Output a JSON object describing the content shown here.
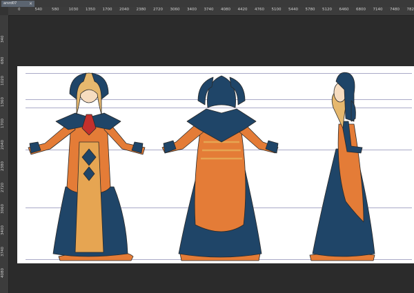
{
  "document": {
    "tab_label": "arsrd07",
    "close_glyph": "×"
  },
  "ruler": {
    "top_labels": [
      "0",
      "540",
      "580",
      "1030",
      "1350",
      "1700",
      "2040",
      "2380",
      "2720",
      "3060",
      "3400",
      "3740",
      "4080",
      "4420",
      "4760",
      "5100",
      "5440",
      "5780",
      "5120",
      "6460",
      "6800",
      "7140",
      "7480",
      "7820"
    ],
    "left_labels": [
      "340",
      "680",
      "1020",
      "1360",
      "1700",
      "2040",
      "2380",
      "2720",
      "3060",
      "3400",
      "3740",
      "4080"
    ]
  },
  "colors": {
    "navy": "#1f4568",
    "orange": "#e47c37",
    "gold": "#e6a552",
    "skin": "#f6dcc0",
    "hair": "#e6b86e",
    "red": "#c4302c",
    "outline": "#2a2a2a"
  },
  "artwork": {
    "figures": [
      "character-front-view",
      "character-back-view",
      "character-side-view"
    ]
  }
}
